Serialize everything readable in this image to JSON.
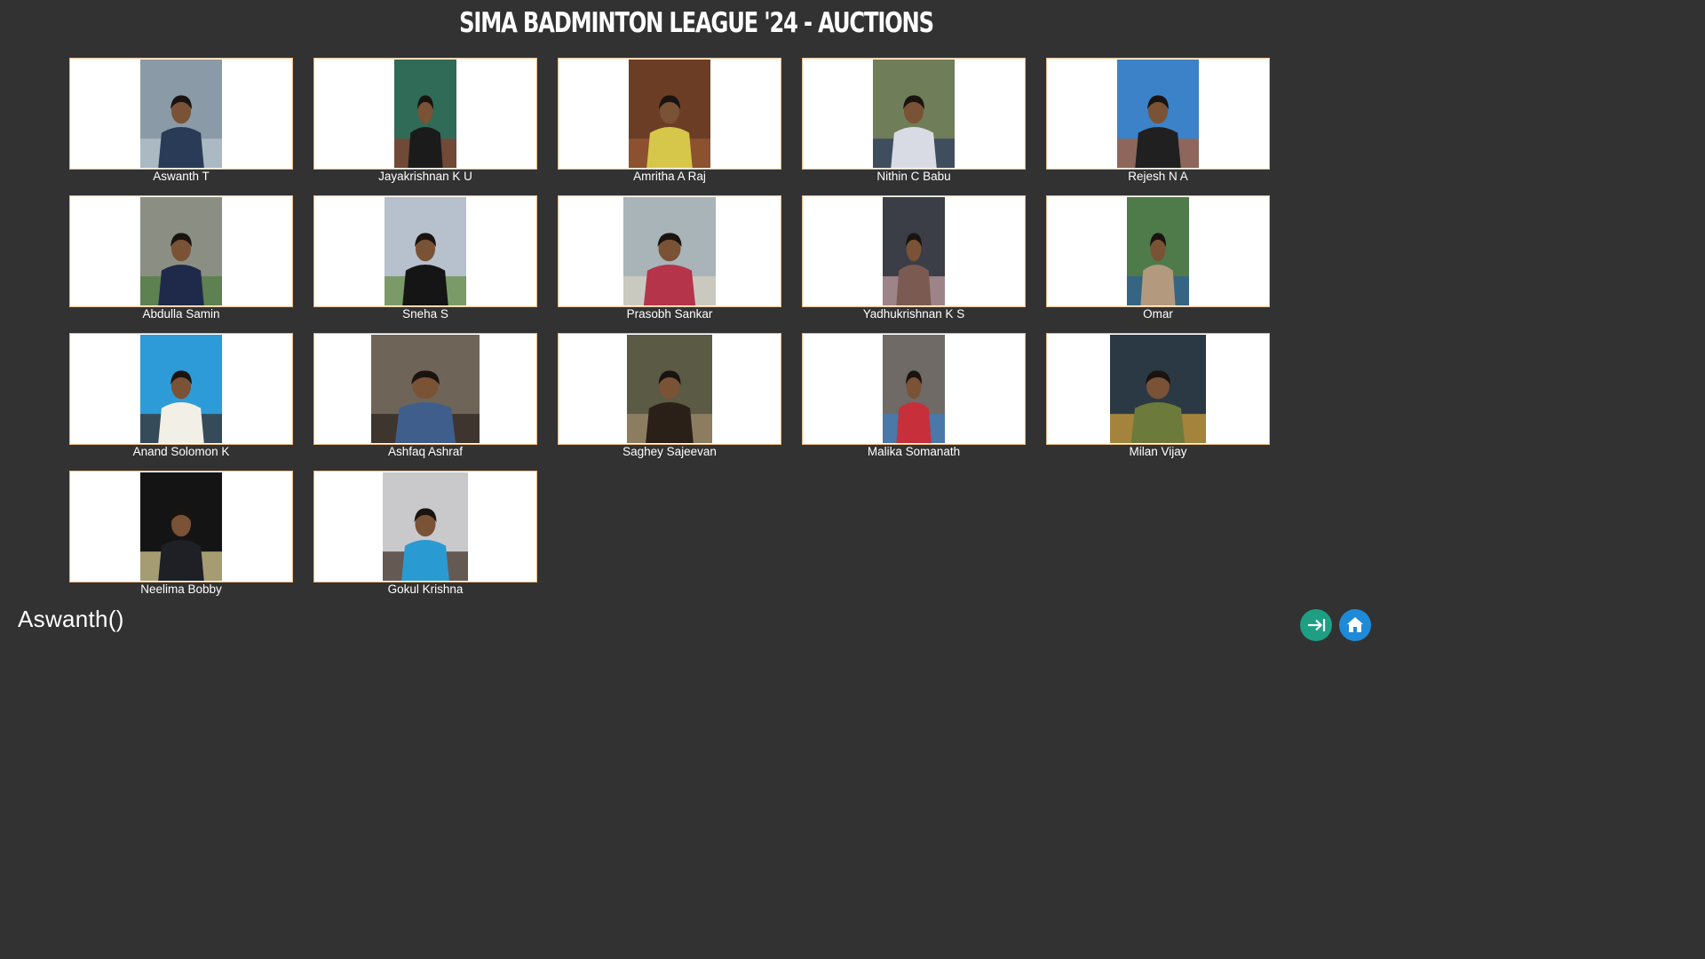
{
  "header": {
    "title": "SIMA BADMINTON LEAGUE '24 - AUCTIONS"
  },
  "players": [
    {
      "name": "Aswanth T",
      "photo_bg": "#8a9aa6",
      "photo_fg": "#2a3b57",
      "photo_accent": "#b8c6cf"
    },
    {
      "name": "Jayakrishnan K U",
      "photo_bg": "#2f6b57",
      "photo_fg": "#1b1b1b",
      "photo_accent": "#8b3a2a"
    },
    {
      "name": "Amritha A Raj",
      "photo_bg": "#6b3d24",
      "photo_fg": "#d6c64a",
      "photo_accent": "#9a5a33"
    },
    {
      "name": "Nithin C Babu",
      "photo_bg": "#6f7d58",
      "photo_fg": "#d9dbe4",
      "photo_accent": "#2b3b62"
    },
    {
      "name": "Rejesh N A",
      "photo_bg": "#3c82c9",
      "photo_fg": "#202020",
      "photo_accent": "#b05a2c"
    },
    {
      "name": "Abdulla Samin",
      "photo_bg": "#8b8f83",
      "photo_fg": "#1f2a4a",
      "photo_accent": "#4a7b3b"
    },
    {
      "name": "Sneha S",
      "photo_bg": "#b7c0cd",
      "photo_fg": "#151515",
      "photo_accent": "#5f8a3c"
    },
    {
      "name": "Prasobh Sankar",
      "photo_bg": "#a8b4b8",
      "photo_fg": "#b5344a",
      "photo_accent": "#d9d2c3"
    },
    {
      "name": "Yadhukrishnan K S",
      "photo_bg": "#3b3d47",
      "photo_fg": "#7b5a52",
      "photo_accent": "#c6a2a4"
    },
    {
      "name": "Omar",
      "photo_bg": "#4f7a4a",
      "photo_fg": "#b39a7e",
      "photo_accent": "#2c5c9b"
    },
    {
      "name": "Anand Solomon K",
      "photo_bg": "#2d9bd8",
      "photo_fg": "#f2efe6",
      "photo_accent": "#3b2a24"
    },
    {
      "name": "Ashfaq Ashraf",
      "photo_bg": "#6e6558",
      "photo_fg": "#3f5e8c",
      "photo_accent": "#2a221d"
    },
    {
      "name": "Saghey Sajeevan",
      "photo_bg": "#5b5a45",
      "photo_fg": "#2a2018",
      "photo_accent": "#a18c6e"
    },
    {
      "name": "Malika Somanath",
      "photo_bg": "#6f6a66",
      "photo_fg": "#c7303b",
      "photo_accent": "#3a7fc4"
    },
    {
      "name": "Milan Vijay",
      "photo_bg": "#2b3944",
      "photo_fg": "#6c7a3b",
      "photo_accent": "#d9a23a"
    },
    {
      "name": "Neelima Bobby",
      "photo_bg": "#141414",
      "photo_fg": "#1f1f26",
      "photo_accent": "#e3d69a"
    },
    {
      "name": "Gokul Krishna",
      "photo_bg": "#c9c9cc",
      "photo_fg": "#2a9ad3",
      "photo_accent": "#3b2a20"
    }
  ],
  "current": {
    "text": "Aswanth()"
  },
  "actions": {
    "next_icon": "skip-to-end-icon",
    "home_icon": "home-icon",
    "next_color": "#1e9f83",
    "home_color": "#1f8ad8"
  }
}
